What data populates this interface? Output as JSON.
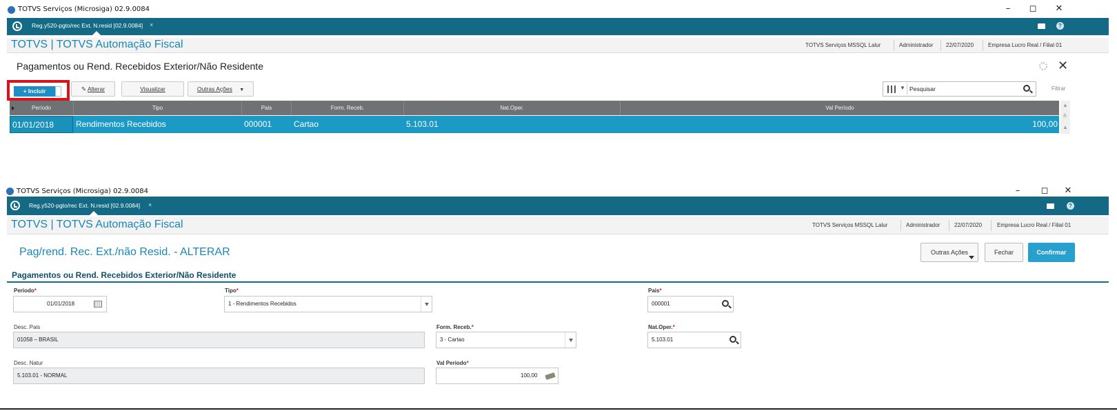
{
  "window": {
    "title": "TOTVS Serviços (Microsiga) 02.9.0084",
    "minimize": "–",
    "maximize": "◻",
    "close": "✕"
  },
  "tabbar": {
    "tab_label": "Reg.y520-pgto/rec Ext. N.resid [02.9.0084]",
    "tab_close": "×"
  },
  "header": {
    "brand": "TOTVS | TOTVS Automação Fiscal",
    "server": "TOTVS Serviços MSSQL Lalur",
    "user": "Administrador",
    "date": "22/07/2020",
    "company": "Empresa Lucro Real / Filial 01"
  },
  "browse": {
    "title": "Pagamentos ou Rend. Recebidos Exterior/Não Residente",
    "toolbar": {
      "incluir": "+ Incluir",
      "alterar": "Alterar",
      "visualizar": "Visualizar",
      "outras_acoes": "Outras Ações",
      "search_placeholder": "Pesquisar",
      "filtrar": "Filtrar"
    },
    "columns": [
      "Período",
      "Tipo",
      "Pais",
      "Form. Receb.",
      "Nat.Oper.",
      "Val Período"
    ],
    "rows": [
      {
        "periodo": "01/01/2018",
        "tipo": "Rendimentos Recebidos",
        "pais": "000001",
        "form_receb": "Cartao",
        "nat_oper": "5.103.01",
        "val_periodo": "100,00"
      }
    ]
  },
  "form": {
    "title": "Pag/rend. Rec. Ext./não Resid. - ALTERAR",
    "buttons": {
      "outras_acoes": "Outras Ações",
      "fechar": "Fechar",
      "confirmar": "Confirmar"
    },
    "section_title": "Pagamentos ou Rend. Recebidos Exterior/Não Residente",
    "required_mark": "*",
    "fields": {
      "periodo": {
        "label": "Periodo",
        "value": "01/01/2018"
      },
      "tipo": {
        "label": "Tipo",
        "value": "1 - Rendimentos Recebidos"
      },
      "pais": {
        "label": "Pais",
        "value": "000001"
      },
      "desc_pais": {
        "label": "Desc. Pais",
        "value": "01058 – BRASIL"
      },
      "form_receb": {
        "label": "Form. Receb.",
        "value": "3 - Cartao"
      },
      "nat_oper": {
        "label": "Nat.Oper.",
        "value": "5.103.01"
      },
      "desc_natur": {
        "label": "Desc. Natur",
        "value": "5.103.01 - NORMAL"
      },
      "val_periodo": {
        "label": "Val Periodo",
        "value": "100,00"
      }
    }
  },
  "colors": {
    "tabbar": "#146a84",
    "brand": "#1b86b6",
    "selected_row": "#1c9ac6",
    "highlight_box": "#d9131b",
    "confirm": "#27a0cf"
  }
}
